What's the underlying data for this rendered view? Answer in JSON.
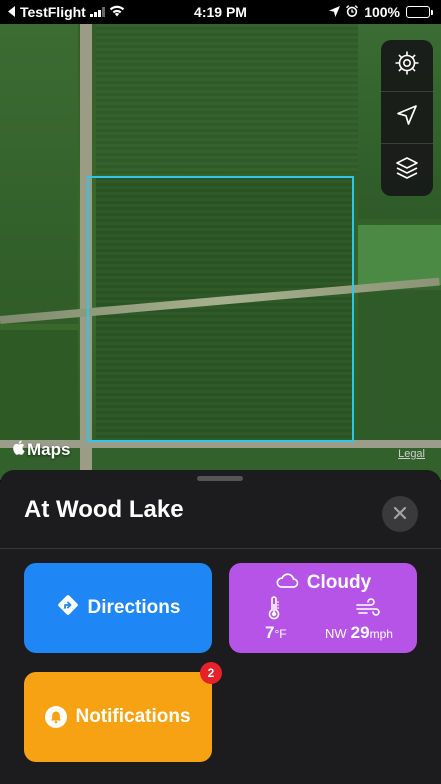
{
  "status_bar": {
    "back_app": "TestFlight",
    "time": "4:19 PM",
    "battery_percent": "100%",
    "battery_level": 1.0
  },
  "map": {
    "provider_label": "Maps",
    "legal_label": "Legal",
    "boundary_color": "#2fc7e7"
  },
  "map_controls": [
    {
      "icon": "gear-icon"
    },
    {
      "icon": "location-arrow-icon"
    },
    {
      "icon": "layers-icon"
    }
  ],
  "sheet": {
    "title": "At Wood Lake",
    "directions_label": "Directions",
    "notifications_label": "Notifications",
    "notifications_badge": "2",
    "weather": {
      "condition": "Cloudy",
      "temperature": "7",
      "temperature_unit": "°F",
      "wind_direction": "NW",
      "wind_speed": "29",
      "wind_unit": "mph"
    }
  },
  "colors": {
    "directions": "#1e86f5",
    "weather": "#b654e8",
    "notifications": "#f7a213",
    "badge": "#e8202a"
  }
}
